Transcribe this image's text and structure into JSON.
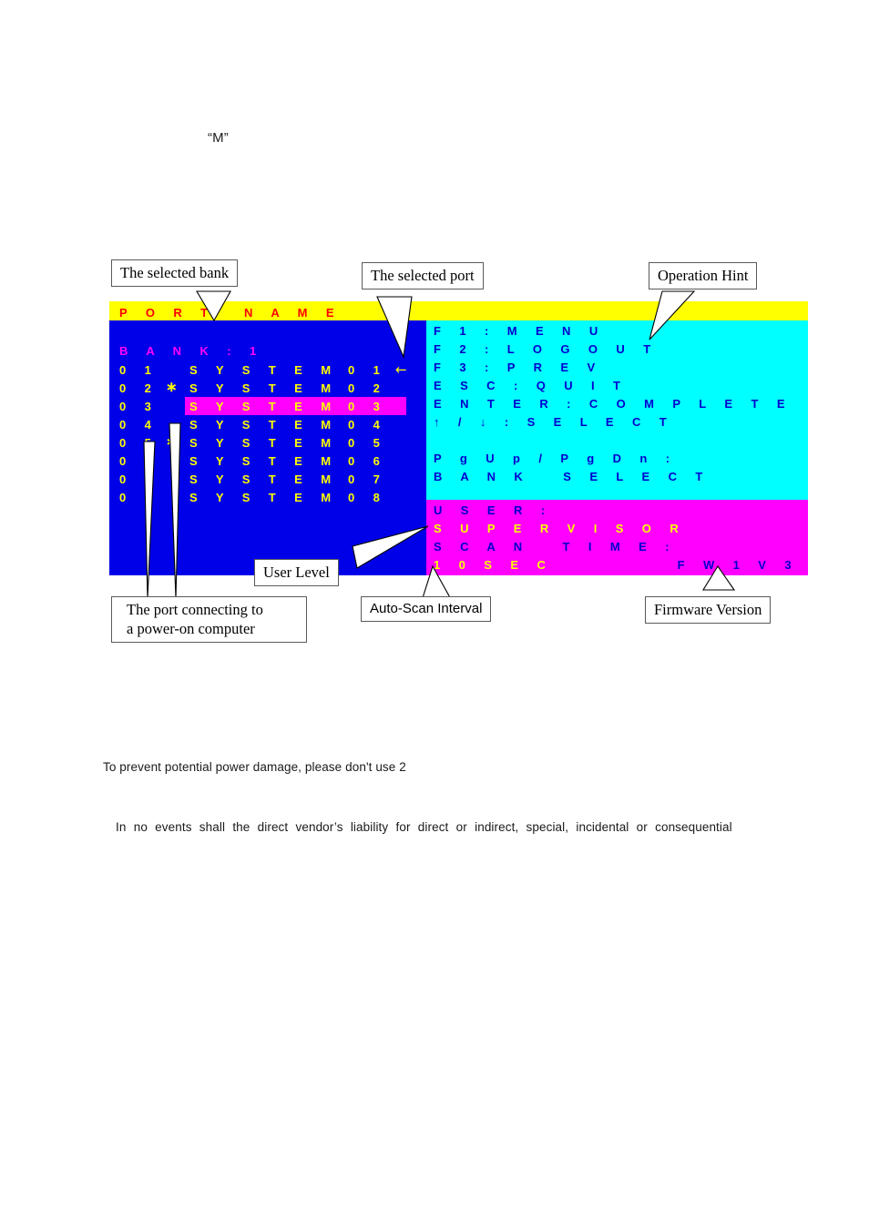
{
  "document": {
    "quote_m": "“M”",
    "warning_line": "To prevent potential power damage, please don't use 2",
    "liability_line": "In no events shall the direct vendor’s liability for direct or indirect, special, incidental or consequential"
  },
  "osd": {
    "colors": {
      "header_bar": "#ffff00",
      "left_panel": "#0000e8",
      "hint_panel": "#00ffff",
      "status_panel": "#ff00ff",
      "header_text": "#ff0000",
      "bank_text": "#ff00ff",
      "port_text": "#ffff00",
      "hint_text": "#0000cd",
      "highlight": "#ff00ff"
    },
    "header": {
      "port_label": "P O R T",
      "name_label": "N A M E"
    },
    "bank_line": "B A N K : 1",
    "ports": [
      {
        "number": "0 1",
        "star": "",
        "name": "S Y S T E M",
        "id": "0 1",
        "selected_arrow": "←",
        "highlighted": false
      },
      {
        "number": "0 2",
        "star": "∗",
        "name": "S Y S T E M",
        "id": "0 2",
        "selected_arrow": "",
        "highlighted": false
      },
      {
        "number": "0 3",
        "star": "",
        "name": "S Y S T E M",
        "id": "0 3",
        "selected_arrow": "",
        "highlighted": true
      },
      {
        "number": "0 4",
        "star": "",
        "name": "S Y S T E M",
        "id": "0 4",
        "selected_arrow": "",
        "highlighted": false
      },
      {
        "number": "0 5",
        "star": "∗",
        "name": "S Y S T E M",
        "id": "0 5",
        "selected_arrow": "",
        "highlighted": false
      },
      {
        "number": "0 6",
        "star": "",
        "name": "S Y S T E M",
        "id": "0 6",
        "selected_arrow": "",
        "highlighted": false
      },
      {
        "number": "0 7",
        "star": "",
        "name": "S Y S T E M",
        "id": "0 7",
        "selected_arrow": "",
        "highlighted": false
      },
      {
        "number": "0 8",
        "star": "",
        "name": "S Y S T E M",
        "id": "0 8",
        "selected_arrow": "",
        "highlighted": false
      }
    ],
    "hints": [
      "F 1 : M E N U",
      "F 2 : L O G O U T",
      "F 3 : P R E V",
      "E S C : Q U I T",
      "E N T E R : C O M P L E T E",
      "↑ / ↓ : S E L E C T",
      "",
      "P g U p / P g D n :",
      "B A N K   S E L E C T"
    ],
    "status": {
      "user_label": "U S E R :",
      "user_value": "S U P E R V I S O R",
      "scan_label": "S C A N   T I M E :",
      "scan_value": "1 0 S E C",
      "firmware": "F W 1 V 3"
    }
  },
  "callouts": {
    "selected_bank": "The selected bank",
    "selected_port": "The selected port",
    "operation_hint": "Operation Hint",
    "user_level": "User Level",
    "power_on_port_line1": "The port connecting to",
    "power_on_port_line2": "a power-on computer",
    "auto_scan_interval": "Auto-Scan Interval",
    "firmware_version": "Firmware Version"
  }
}
